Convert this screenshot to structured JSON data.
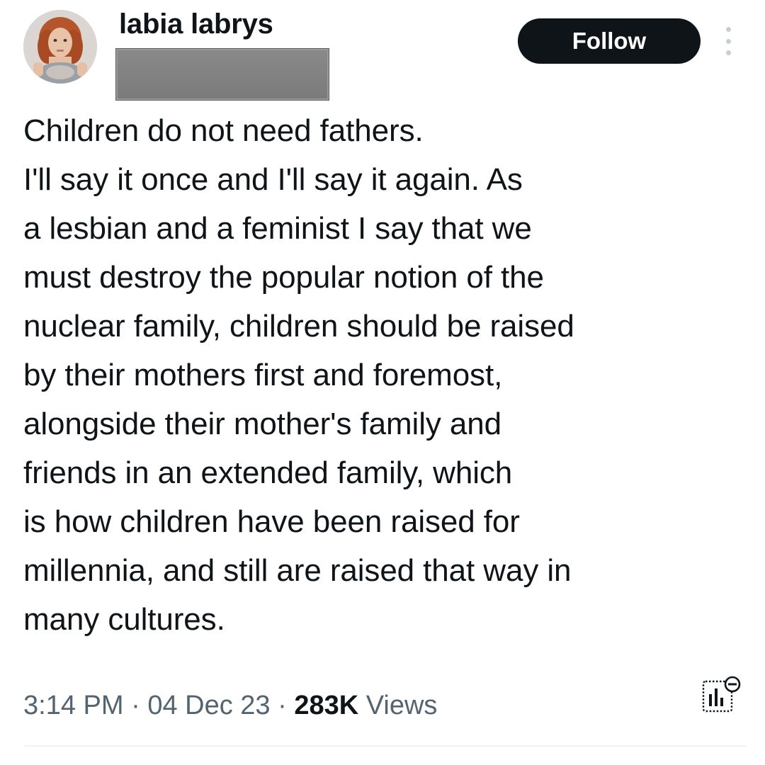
{
  "tweet": {
    "author": {
      "display_name": "labia labrys",
      "avatar_icon": "profile-photo"
    },
    "follow_label": "Follow",
    "more_icon": "more-vertical-icon",
    "text_lines": [
      "Children do not need fathers.",
      "I'll say it once and I'll say it again. As",
      "a lesbian and a feminist I say that we",
      "must destroy the popular notion of the",
      "nuclear family, children should be raised",
      "by their mothers first and foremost,",
      "alongside their mother's family and",
      "friends in an extended family, which",
      "is how children have been raised for",
      "millennia, and still are raised that way in",
      "many cultures."
    ],
    "meta": {
      "time": "3:14 PM",
      "separator": " · ",
      "date": "04 Dec 23",
      "views_count": "283K",
      "views_label": " Views"
    },
    "analytics_icon": "analytics-icon"
  },
  "colors": {
    "text_primary": "#0f1419",
    "text_secondary": "#536471",
    "button_bg": "#0f1419",
    "button_text": "#ffffff",
    "redaction": "#7f7f7f"
  }
}
